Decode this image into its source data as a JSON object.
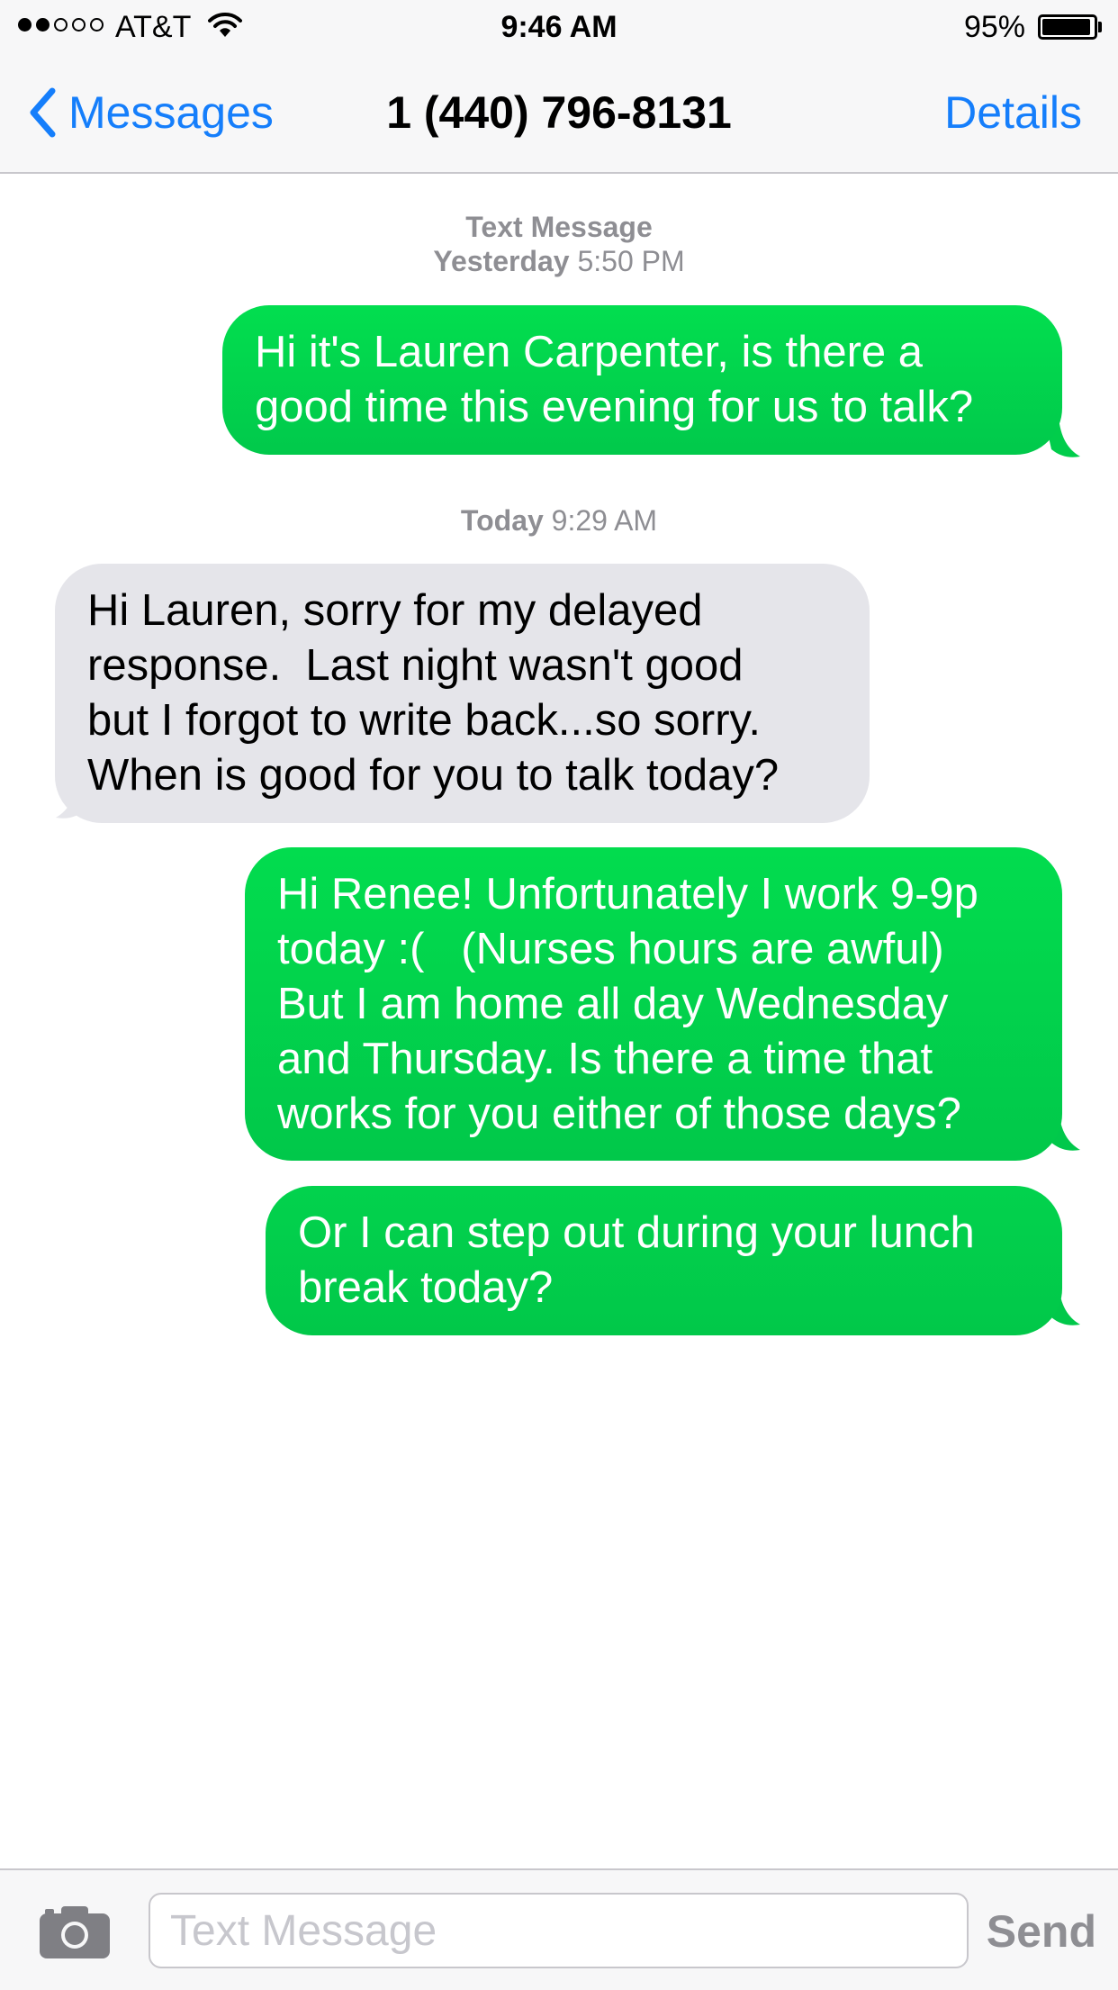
{
  "status_bar": {
    "signal_bars_filled": 2,
    "signal_bars_total": 5,
    "carrier": "AT&T",
    "wifi_icon": "wifi-icon",
    "time": "9:46 AM",
    "battery_percent": "95%",
    "battery_level": 0.95
  },
  "nav": {
    "back_label": "Messages",
    "back_icon": "chevron-left-icon",
    "title": "1 (440) 796-8131",
    "details_label": "Details"
  },
  "colors": {
    "accent_blue": "#157efb",
    "sent_bubble_top": "#02de4f",
    "sent_bubble_bottom": "#01c84b",
    "received_bubble": "#e5e5ea",
    "timestamp_gray": "#8e8e93"
  },
  "conversation": {
    "header_label": "Text Message",
    "groups": [
      {
        "day": "Yesterday",
        "time": "5:50 PM",
        "messages": [
          {
            "direction": "sent",
            "lines": [
              "Hi it's Lauren Carpenter, is there a",
              "good time this evening for us to talk?"
            ]
          }
        ]
      },
      {
        "day": "Today",
        "time": "9:29 AM",
        "messages": [
          {
            "direction": "received",
            "lines": [
              "Hi Lauren, sorry for my delayed",
              "response.  Last night wasn't good",
              "but I forgot to write back...so sorry.",
              "When is good for you to talk today?"
            ]
          },
          {
            "direction": "sent",
            "lines": [
              "Hi Renee! Unfortunately I work 9-9p",
              "today :(   (Nurses hours are awful)",
              "But I am home all day Wednesday",
              "and Thursday. Is there a time that",
              "works for you either of those days?"
            ]
          },
          {
            "direction": "sent",
            "lines": [
              "Or I can step out during your lunch",
              "break today?"
            ]
          }
        ]
      }
    ]
  },
  "input_bar": {
    "camera_icon": "camera-icon",
    "placeholder": "Text Message",
    "value": "",
    "send_label": "Send"
  }
}
